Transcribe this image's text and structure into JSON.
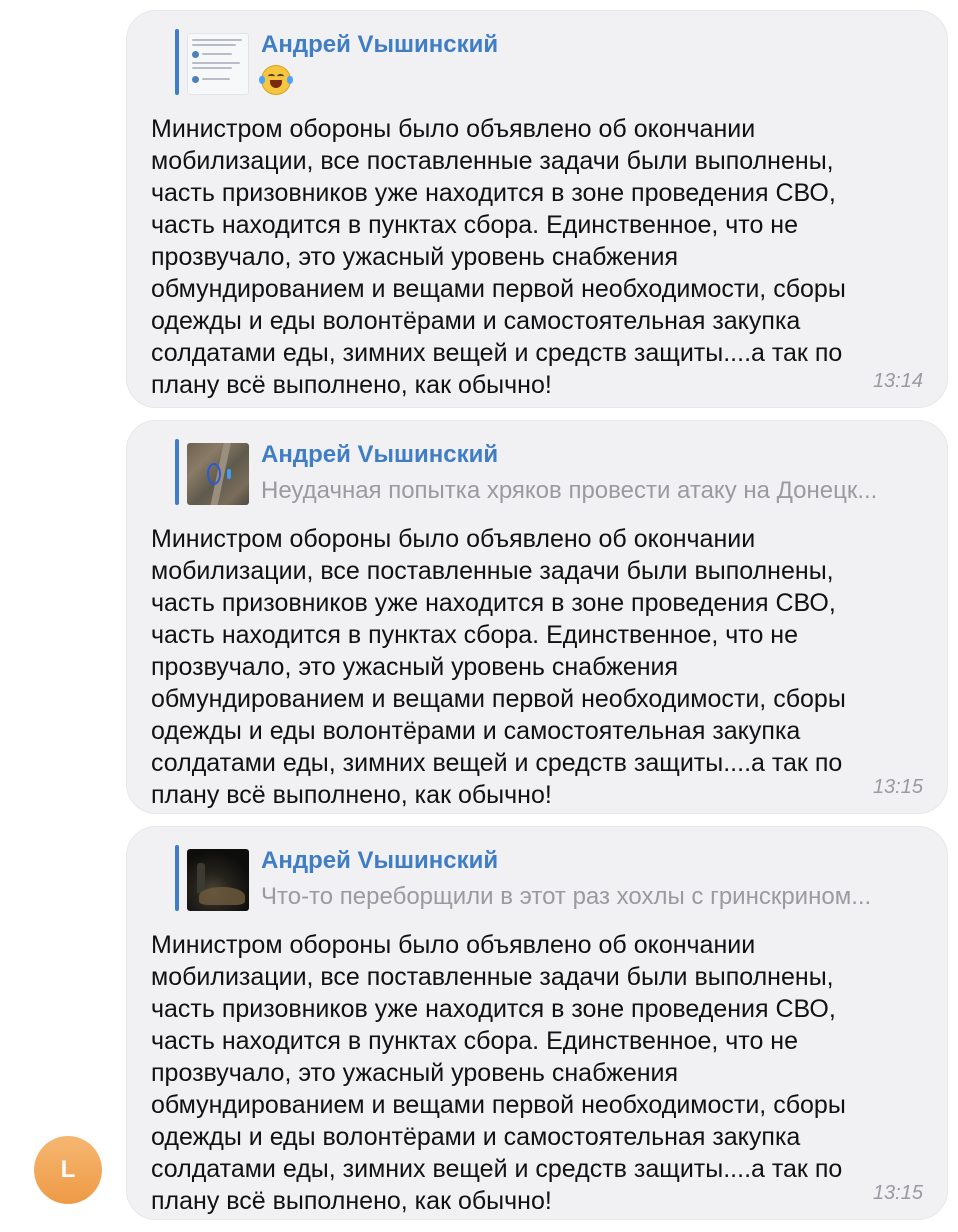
{
  "messages": [
    {
      "reply_name": "Андрей Vышинский",
      "reply_sub": "",
      "text": "Министром обороны было объявлено об окончании\nмобилизации, все поставленные задачи были выполнены,\nчасть призовников уже находится в зоне проведения СВО,\nчасть находится в пунктах сбора. Единственное, что не\nпрозвучало, это ужасный уровень снабжения\nобмундированием и вещами первой необходимости, сборы\nодежды и еды волонтёрами и самостоятельная закупка\nсолдатами еды, зимних вещей и средств защиты....а так по\nплану всё выполнено, как обычно!",
      "time": "13:14"
    },
    {
      "reply_name": "Андрей Vышинский",
      "reply_sub": "Неудачная попытка хряков провести атаку на Донецк...",
      "text": "Министром обороны было объявлено об окончании\nмобилизации, все поставленные задачи были выполнены,\nчасть призовников уже находится в зоне проведения СВО,\nчасть находится в пунктах сбора. Единственное, что не\nпрозвучало, это ужасный уровень снабжения\nобмундированием и вещами первой необходимости, сборы\nодежды и еды волонтёрами и самостоятельная закупка\nсолдатами еды, зимних вещей и средств защиты....а так по\nплану всё выполнено, как обычно!",
      "time": "13:15"
    },
    {
      "reply_name": "Андрей Vышинский",
      "reply_sub": "Что-то переборщили в этот раз хохлы с гринскрином...",
      "text": "Министром обороны было объявлено об окончании\nмобилизации, все поставленные задачи были выполнены,\nчасть призовников уже находится в зоне проведения СВО,\nчасть находится в пунктах сбора. Единственное, что не\nпрозвучало, это ужасный уровень снабжения\nобмундированием и вещами первой необходимости, сборы\nодежды и еды волонтёрами и самостоятельная закупка\nсолдатами еды, зимних вещей и средств защиты....а так по\nплану всё выполнено, как обычно!",
      "time": "13:15"
    }
  ],
  "avatar": {
    "initial": "L",
    "color": "#f2a550"
  },
  "colors": {
    "accent": "#3f7dc4",
    "bubble": "#f1f1f4",
    "meta_text": "#9a9aa0"
  }
}
